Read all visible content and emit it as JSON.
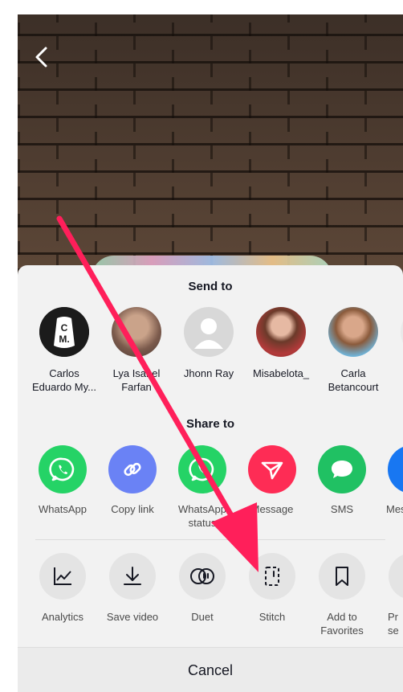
{
  "background": {
    "description_color": "#3b2d24"
  },
  "nav": {
    "back_icon": "chevron-left-icon"
  },
  "sheet": {
    "send_to_title": "Send to",
    "contacts": [
      {
        "name_line1": "Carlos",
        "name_line2": "Eduardo My...",
        "avatar": "cm-logo-avatar"
      },
      {
        "name_line1": "Lya Isabel",
        "name_line2": "Farfan",
        "avatar": "photo-avatar"
      },
      {
        "name_line1": "Jhonn Ray",
        "name_line2": "",
        "avatar": "default-avatar"
      },
      {
        "name_line1": "Misabelota_",
        "name_line2": "",
        "avatar": "photo-avatar"
      },
      {
        "name_line1": "Carla",
        "name_line2": "Betancourt",
        "avatar": "photo-avatar"
      }
    ],
    "share_to_title": "Share to",
    "share_items": [
      {
        "line1": "WhatsApp",
        "line2": "",
        "icon": "whatsapp-icon",
        "color": "#25d366"
      },
      {
        "line1": "Copy link",
        "line2": "",
        "icon": "link-icon",
        "color": "#6a82f5"
      },
      {
        "line1": "WhatsApp",
        "line2": "status",
        "icon": "whatsapp-icon",
        "color": "#25d366"
      },
      {
        "line1": "Message",
        "line2": "",
        "icon": "send-icon",
        "color": "#fe2c55"
      },
      {
        "line1": "SMS",
        "line2": "",
        "icon": "chat-bubble-icon",
        "color": "#20c163"
      },
      {
        "line1": "Mes",
        "line2": "",
        "icon": "messenger-icon",
        "color": "#1877f2"
      }
    ],
    "actions": [
      {
        "line1": "Analytics",
        "line2": "",
        "icon": "analytics-icon"
      },
      {
        "line1": "Save video",
        "line2": "",
        "icon": "download-icon"
      },
      {
        "line1": "Duet",
        "line2": "",
        "icon": "duet-icon"
      },
      {
        "line1": "Stitch",
        "line2": "",
        "icon": "stitch-icon"
      },
      {
        "line1": "Add to",
        "line2": "Favorites",
        "icon": "bookmark-icon"
      },
      {
        "line1": "Pr",
        "line2": "se",
        "icon": "more-icon"
      }
    ],
    "cancel_label": "Cancel"
  },
  "annotation": {
    "arrow_color": "#ff1f5a"
  }
}
